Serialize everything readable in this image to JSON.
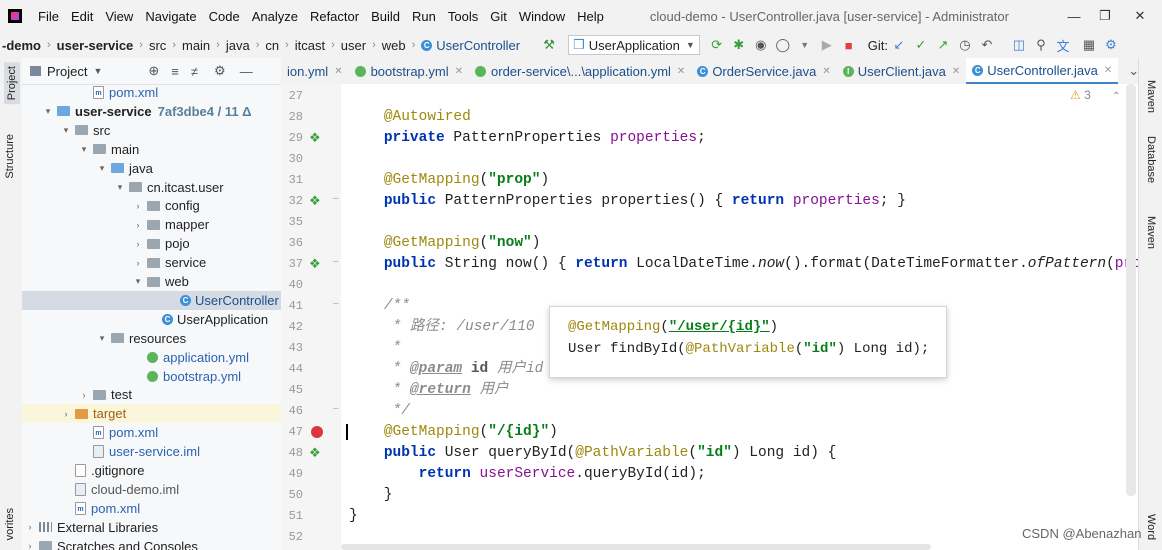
{
  "menubar": {
    "items": [
      "File",
      "Edit",
      "View",
      "Navigate",
      "Code",
      "Analyze",
      "Refactor",
      "Build",
      "Run",
      "Tools",
      "Git",
      "Window",
      "Help"
    ],
    "title": "cloud-demo - UserController.java [user-service] - Administrator"
  },
  "navbar": {
    "crumbs": [
      "-demo",
      "user-service",
      "src",
      "main",
      "java",
      "cn",
      "itcast",
      "user",
      "web",
      "UserController"
    ],
    "run_config": "UserApplication",
    "git_label": "Git:"
  },
  "left_strip": {
    "project": "Project",
    "structure": "Structure",
    "favorites": "vorites"
  },
  "project_panel": {
    "title": "Project",
    "tree": [
      {
        "label": "pom.xml",
        "indent": 56,
        "icon": "maven",
        "arrow": ""
      },
      {
        "label": "user-service",
        "extra": "7af3dbe4 / 11 Δ",
        "indent": 20,
        "icon": "module",
        "arrow": "▾",
        "bold": true
      },
      {
        "label": "src",
        "indent": 38,
        "icon": "folder",
        "arrow": "▾"
      },
      {
        "label": "main",
        "indent": 56,
        "icon": "folder",
        "arrow": "▾"
      },
      {
        "label": "java",
        "indent": 74,
        "icon": "folder-blue",
        "arrow": "▾"
      },
      {
        "label": "cn.itcast.user",
        "indent": 92,
        "icon": "folder",
        "arrow": "▾"
      },
      {
        "label": "config",
        "indent": 110,
        "icon": "folder",
        "arrow": "›"
      },
      {
        "label": "mapper",
        "indent": 110,
        "icon": "folder",
        "arrow": "›"
      },
      {
        "label": "pojo",
        "indent": 110,
        "icon": "folder",
        "arrow": "›"
      },
      {
        "label": "service",
        "indent": 110,
        "icon": "folder",
        "arrow": "›"
      },
      {
        "label": "web",
        "indent": 110,
        "icon": "folder",
        "arrow": "▾"
      },
      {
        "label": "UserController",
        "indent": 143,
        "icon": "class",
        "arrow": "",
        "selected": true
      },
      {
        "label": "UserApplication",
        "indent": 125,
        "icon": "spring-class",
        "arrow": ""
      },
      {
        "label": "resources",
        "indent": 74,
        "icon": "folder-res",
        "arrow": "▾"
      },
      {
        "label": "application.yml",
        "indent": 110,
        "icon": "leaf",
        "arrow": ""
      },
      {
        "label": "bootstrap.yml",
        "indent": 110,
        "icon": "leaf",
        "arrow": ""
      },
      {
        "label": "test",
        "indent": 56,
        "icon": "folder",
        "arrow": "›"
      },
      {
        "label": "target",
        "indent": 38,
        "icon": "folder-orange",
        "arrow": "›",
        "target": true
      },
      {
        "label": "pom.xml",
        "indent": 56,
        "icon": "maven",
        "arrow": ""
      },
      {
        "label": "user-service.iml",
        "indent": 56,
        "icon": "iml",
        "arrow": ""
      },
      {
        "label": ".gitignore",
        "indent": 38,
        "icon": "file",
        "arrow": ""
      },
      {
        "label": "cloud-demo.iml",
        "indent": 38,
        "icon": "iml",
        "arrow": ""
      },
      {
        "label": "pom.xml",
        "indent": 38,
        "icon": "maven",
        "arrow": ""
      },
      {
        "label": "External Libraries",
        "indent": 2,
        "icon": "lib",
        "arrow": "›"
      },
      {
        "label": "Scratches and Consoles",
        "indent": 2,
        "icon": "scratch",
        "arrow": "›"
      }
    ]
  },
  "tabs": [
    {
      "label": "ion.yml",
      "icon": "none"
    },
    {
      "label": "bootstrap.yml",
      "icon": "leaf"
    },
    {
      "label": "order-service\\...\\application.yml",
      "icon": "leaf"
    },
    {
      "label": "OrderService.java",
      "icon": "class"
    },
    {
      "label": "UserClient.java",
      "icon": "interface"
    },
    {
      "label": "UserController.java",
      "icon": "class",
      "active": true
    }
  ],
  "editor": {
    "warnings": "3",
    "lines": [
      {
        "n": "27",
        "html": ""
      },
      {
        "n": "28",
        "html": "    <span class='ann'>@Autowired</span>"
      },
      {
        "n": "29",
        "html": "    <span class='kw'>private</span> PatternProperties <span class='fld'>properties</span>;"
      },
      {
        "n": "30",
        "html": ""
      },
      {
        "n": "31",
        "html": "    <span class='ann'>@GetMapping</span>(<span class='str'>\"prop\"</span>)"
      },
      {
        "n": "32",
        "html": "    <span class='kw'>public</span> PatternProperties properties() { <span class='kw'>return</span> <span class='fld'>properties</span>; }"
      },
      {
        "n": "35",
        "html": ""
      },
      {
        "n": "36",
        "html": "    <span class='ann'>@GetMapping</span>(<span class='str'>\"now\"</span>)"
      },
      {
        "n": "37",
        "html": "    <span class='kw'>public</span> String now() { <span class='kw'>return</span> LocalDateTime.<span class='ital'>now</span>().format(DateTimeFormatter.<span class='ital'>ofPattern</span>(<span class='fld'>proper</span>"
      },
      {
        "n": "40",
        "html": ""
      },
      {
        "n": "41",
        "html": "    <span class='cmt'>/**</span>"
      },
      {
        "n": "42",
        "html": "<span class='cmt'>     * 路径: /user/110</span>"
      },
      {
        "n": "43",
        "html": "<span class='cmt'>     *</span>"
      },
      {
        "n": "44",
        "html": "<span class='cmt'>     * </span><span class='doctag'>@param</span><span class='cmt'> </span><span class='cmt' style='font-weight:bold;font-style:normal;color:#555'>id</span><span class='cmt'> 用户id</span>"
      },
      {
        "n": "45",
        "html": "<span class='cmt'>     * </span><span class='doctag'>@return</span><span class='cmt'> 用户</span>"
      },
      {
        "n": "46",
        "html": "<span class='cmt'>     */</span>"
      },
      {
        "n": "47",
        "html": "    <span class='ann'>@GetMapping</span>(<span class='str'>\"/{id}\"</span>)"
      },
      {
        "n": "48",
        "html": "    <span class='kw'>public</span> User queryById(<span class='ann'>@PathVariable</span>(<span class='str'>\"id\"</span>) Long id) {"
      },
      {
        "n": "49",
        "html": "        <span class='kw'>return</span> <span class='fld'>userService</span>.queryById(id);"
      },
      {
        "n": "50",
        "html": "    }"
      },
      {
        "n": "51",
        "html": "}"
      },
      {
        "n": "52",
        "html": ""
      }
    ]
  },
  "popup": {
    "line1": "<span class='ann'>@GetMapping</span>(<span class='str' style='text-decoration:underline'>\"/user/{id}\"</span>)",
    "line2": "User findById(<span class='ann'>@PathVariable</span>(<span class='str'>\"id\"</span>) Long id);"
  },
  "right_strip": {
    "maven_top": "Maven",
    "database": "Database",
    "maven": "Maven",
    "word": "Word"
  },
  "watermark": "CSDN @Abenazhan"
}
